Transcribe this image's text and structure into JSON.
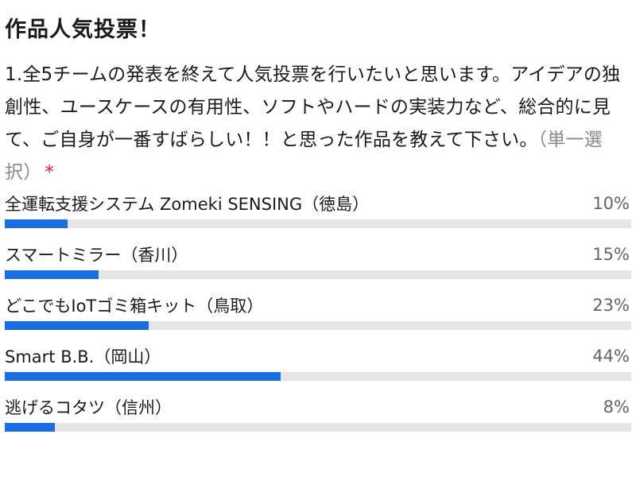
{
  "poll": {
    "title": "作品人気投票！",
    "question": {
      "text": "1.全5チームの発表を終えて人気投票を行いたいと思います。アイデアの独創性、ユースケースの有用性、ソフトやハードの実装力など、総合的に見て、ご自身が一番すばらしい！！と思った作品を教えて下さい。",
      "type_label": "（単一選択）",
      "required_mark": "*"
    },
    "options": [
      {
        "label": "全運転支援システム Zomeki SENSING（徳島）",
        "percent_label": "10%",
        "fraction": 0.1
      },
      {
        "label": "スマートミラー（香川）",
        "percent_label": "15%",
        "fraction": 0.15
      },
      {
        "label": "どこでもIoTゴミ箱キット（鳥取）",
        "percent_label": "23%",
        "fraction": 0.23
      },
      {
        "label": "Smart B.B.（岡山）",
        "percent_label": "44%",
        "fraction": 0.44
      },
      {
        "label": "逃げるコタツ（信州）",
        "percent_label": "8%",
        "fraction": 0.08
      }
    ],
    "colors": {
      "bar_fill": "#1a6ee0",
      "bar_track": "#e6e6e6",
      "required": "#e0202c"
    }
  }
}
